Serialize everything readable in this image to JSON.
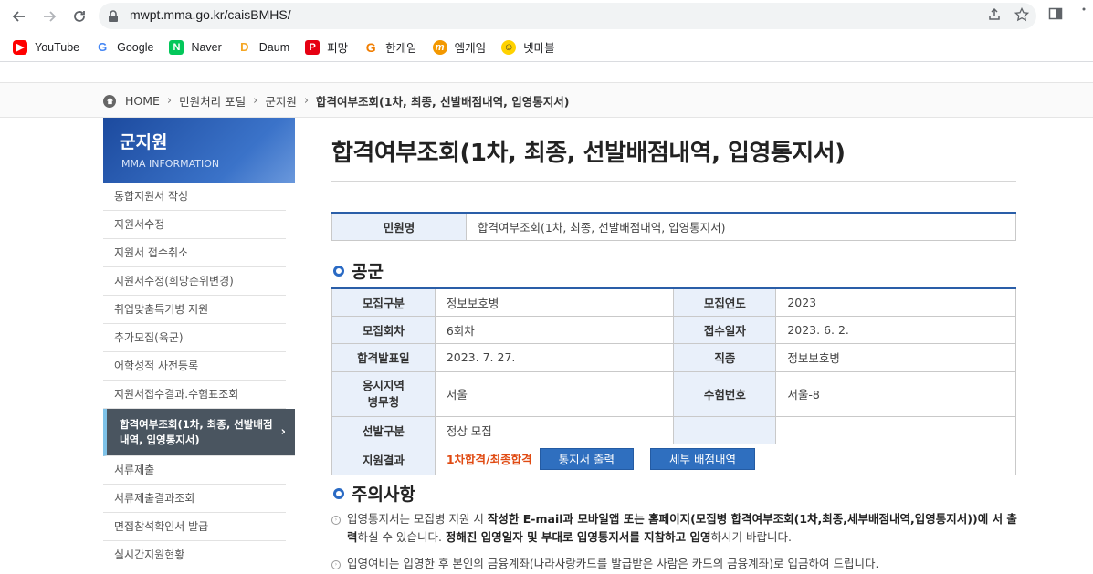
{
  "browser": {
    "url": "mwpt.mma.go.kr/caisBMHS/",
    "bookmarks": [
      {
        "label": "YouTube",
        "color": "#ff0000",
        "glyph": "▶"
      },
      {
        "label": "Google",
        "color": "#ffffff",
        "glyph": "G"
      },
      {
        "label": "Naver",
        "color": "#03c75a",
        "glyph": "N"
      },
      {
        "label": "Daum",
        "color": "#ffffff",
        "glyph": "D"
      },
      {
        "label": "피망",
        "color": "#e60012",
        "glyph": "P"
      },
      {
        "label": "한게임",
        "color": "#ffffff",
        "glyph": "G"
      },
      {
        "label": "엠게임",
        "color": "#f39800",
        "glyph": "m"
      },
      {
        "label": "넷마블",
        "color": "#ffffff",
        "glyph": "☺"
      }
    ]
  },
  "breadcrumb": [
    "HOME",
    "민원처리 포털",
    "군지원",
    "합격여부조회(1차, 최종, 선발배점내역, 입영통지서)"
  ],
  "sidebar": {
    "title": "군지원",
    "subtitle": "MMA INFORMATION",
    "items": [
      "통합지원서 작성",
      "지원서수정",
      "지원서 접수취소",
      "지원서수정(희망순위변경)",
      "취업맞춤특기병 지원",
      "추가모집(육군)",
      "어학성적 사전등록",
      "지원서접수결과.수험표조회",
      "합격여부조회(1차, 최종, 선발배점내역, 입영통지서)",
      "서류제출",
      "서류제출결과조회",
      "면접참석확인서 발급",
      "실시간지원현황"
    ]
  },
  "main": {
    "title": "합격여부조회(1차, 최종, 선발배점내역, 입영통지서)",
    "service_label": "민원명",
    "service_value": "합격여부조회(1차, 최종, 선발배점내역, 입영통지서)",
    "section1": "공군",
    "fields": {
      "recruit_type_label": "모집구분",
      "recruit_type": "정보보호병",
      "recruit_year_label": "모집연도",
      "recruit_year": "2023",
      "round_label": "모집회차",
      "round": "6회차",
      "apply_date_label": "접수일자",
      "apply_date": "2023. 6. 2.",
      "announce_label": "합격발표일",
      "announce": "2023. 7. 27.",
      "job_label": "직종",
      "job": "정보보호병",
      "region_label1": "응시지역",
      "region_label2": "병무청",
      "region": "서울",
      "exam_no_label": "수험번호",
      "exam_no": "서울-8",
      "selection_label": "선발구분",
      "selection": "정상 모집",
      "result_label": "지원결과",
      "result": "1차합격/최종합격",
      "btn_notice": "통지서 출력",
      "btn_score": "세부 배점내역"
    },
    "section2": "주의사항",
    "notes": {
      "n1_a": "입영통지서는 모집병 지원 시 ",
      "n1_b": "작성한 E-mail과 모바일앱 또는 홈페이지(모집병 합격여부조회(1차,최종,세부배점내역,입영통지서))에 서 출력",
      "n1_c": "하실 수 있습니다. ",
      "n1_d": "정해진 입영일자 및 부대로 입영통지서를 지참하고 입영",
      "n1_e": "하시기 바랍니다.",
      "n2": "입영여비는 입영한 후 본인의 금융계좌(나라사랑카드를 발급받은 사람은 카드의 금융계좌)로 입금하여 드립니다."
    }
  }
}
